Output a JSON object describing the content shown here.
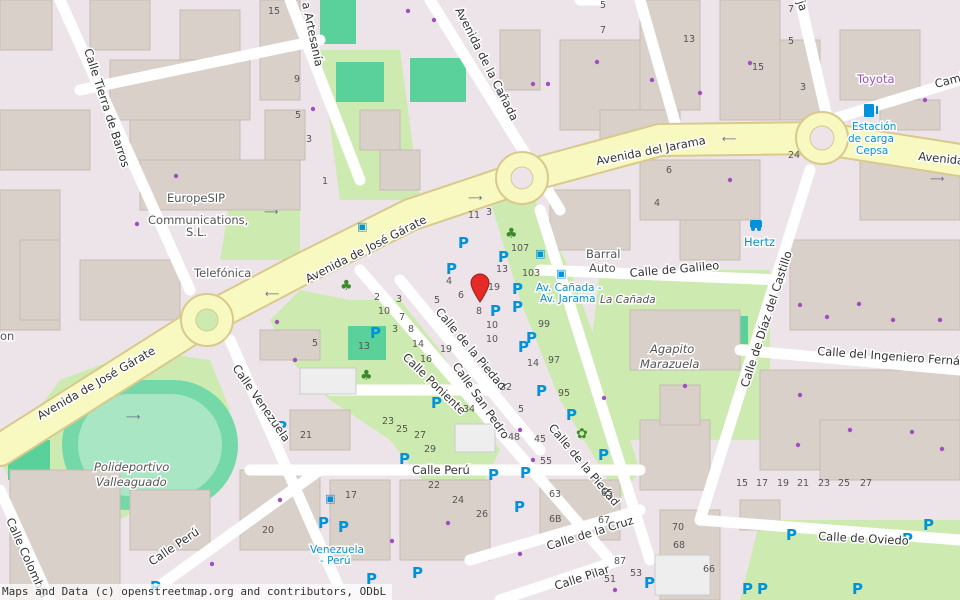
{
  "map": {
    "attribution": "Maps and Data (c) openstreetmap.org and contributors, ODbL",
    "marker_color": "#e52b25",
    "colors": {
      "landuse": "#ede4ea",
      "building": "#d9d0c9",
      "primary_road": "#f7f9c0",
      "primary_casing": "#d9c98d",
      "park": "#cdebb0",
      "pitch": "#5ad19a",
      "parking_blue": "#0092da",
      "poi_purple": "#a04ec1"
    },
    "streets": {
      "av_canada": "Avenida de la Cañada",
      "av_jarama": "Avenida del Jarama",
      "av_jarama_east": "Avenida",
      "av_jose_garate_1": "Avenida de José Gárate",
      "av_jose_garate_2": "Avenida de José Gárate",
      "calle_artesania": "a Artesanía",
      "calle_tierra_barros": "Calle Tierra de Barros",
      "calle_galileo": "Calle de Galileo",
      "calle_diaz_castillo": "Calle de Díaz del Castillo",
      "calle_ingeniero": "Calle del Ingeniero Fernánde",
      "calle_piedad_1": "Calle de la Piedad",
      "calle_piedad_2": "Calle de la Piedad",
      "calle_poniente": "Calle Poniente",
      "calle_san_pedro": "Calle San Pedro",
      "calle_venezuela": "Calle Venezuela",
      "calle_peru_1": "Calle Perú",
      "calle_peru_2": "Calle Perú",
      "calle_colombia": "Calle Colombia",
      "calle_cruz": "Calle de la Cruz",
      "calle_pilar": "Calle Pilar",
      "calle_oviedo": "Calle de Oviedo",
      "calle_camino": "Cami",
      "ja": "ja"
    },
    "pois": {
      "europesip": "EuropeSIP Communications, S.L.",
      "telefonica": "Telefónica",
      "barral_auto": "Barral Auto",
      "la_canada": "La Cañada",
      "agapito": "Agapito Marazuela",
      "toyota": "Toyota",
      "cepsa": "Estación de carga Cepsa",
      "hertz": "Hertz",
      "polideportivo": "Polideportivo Valleaguado",
      "bus_canada": "Av. Cañada - Av. Jarama",
      "bus_venezuela": "Venezuela - Perú",
      "left_edge": "on"
    },
    "house_numbers": [
      "15",
      "9",
      "5",
      "3",
      "1",
      "13",
      "15",
      "5",
      "7",
      "5",
      "3",
      "24",
      "6",
      "4",
      "15",
      "3",
      "107",
      "103",
      "99",
      "97",
      "95",
      "13",
      "19",
      "8",
      "10",
      "14",
      "32",
      "34",
      "48",
      "45",
      "55",
      "63",
      "65",
      "67",
      "87",
      "6B",
      "11",
      "10",
      "6",
      "2",
      "3",
      "4",
      "5",
      "7",
      "8",
      "10",
      "14",
      "16",
      "19",
      "21",
      "23",
      "25",
      "27",
      "29",
      "22",
      "24",
      "26",
      "20",
      "17",
      "15",
      "17",
      "19",
      "21",
      "23",
      "25",
      "27",
      "70",
      "68",
      "66",
      "51",
      "53",
      "3",
      "5",
      "13"
    ]
  }
}
